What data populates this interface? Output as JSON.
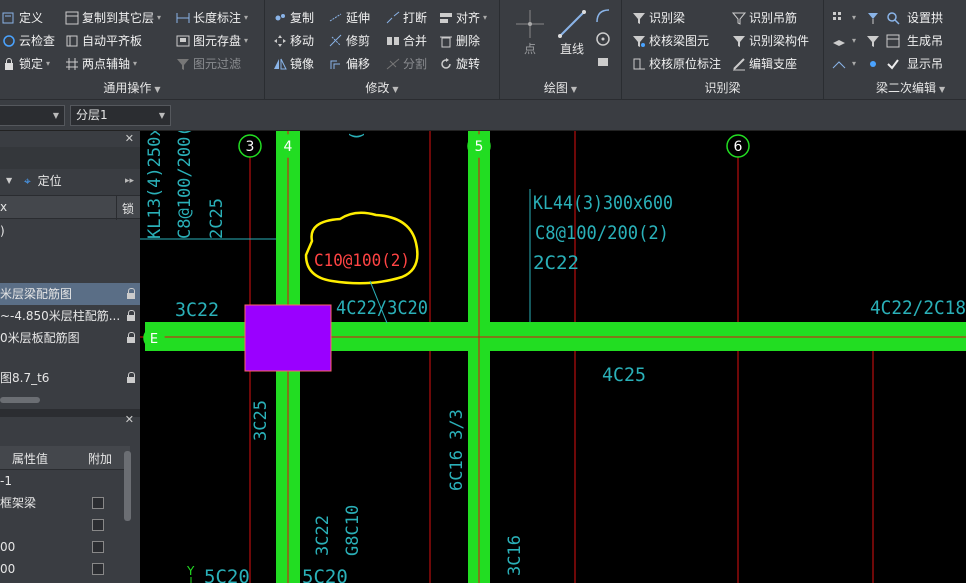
{
  "ribbon": {
    "groups": {
      "common": {
        "title": "通用操作",
        "items": [
          "定义",
          "复制到其它层",
          "长度标注",
          "云检查",
          "自动平齐板",
          "图元存盘",
          "锁定",
          "两点辅轴",
          "图元过滤"
        ]
      },
      "modify": {
        "title": "修改",
        "items": [
          "复制",
          "延伸",
          "打断",
          "对齐",
          "移动",
          "修剪",
          "合并",
          "删除",
          "镜像",
          "偏移",
          "分割",
          "旋转"
        ]
      },
      "draw": {
        "title": "绘图",
        "point": "点",
        "line": "直线"
      },
      "identify_beam": {
        "title": "识别梁",
        "items": [
          "识别梁",
          "识别吊筋",
          "校核梁图元",
          "识别梁构件",
          "校核原位标注",
          "编辑支座"
        ]
      },
      "beam_edit": {
        "title": "梁二次编辑",
        "items": [
          "设置拱",
          "生成吊",
          "显示吊"
        ]
      }
    }
  },
  "layerbar": {
    "floor_combo": "分层1"
  },
  "leftpanel": {
    "locate_label": "定位",
    "lock_col": "锁",
    "row_paren": ")",
    "row_x": "x",
    "drawings": [
      "米层梁配筋图",
      "~-4.850米层柱配筋...",
      "0米层板配筋图",
      "图8.7_t6"
    ],
    "props_header": {
      "value": "属性值",
      "extra": "附加"
    },
    "props": [
      "-1",
      "框架梁",
      "",
      "00",
      "00"
    ]
  },
  "canvas": {
    "axes": {
      "a3": "3",
      "a4": "4",
      "a5": "5",
      "a6": "6",
      "aE": "E"
    },
    "annotations": {
      "kl13": "KL13(4)250x",
      "kl13_stirrup": "C8@100/200(2",
      "kl13_top": "2C25",
      "kl44": "KL44(3)300x600",
      "kl44_stirrup": "C8@100/200(2)",
      "kl44_top": "2C22",
      "circled": "C10@100(2)",
      "left_3c22": "3C22",
      "mid_4c22": "4C22/3C20",
      "right_4c22": "4C22/2C18",
      "bottom_4c25": "4C25",
      "v_3c25": "3C25",
      "v_6c16": "6C16 3/3",
      "v_3c22": "3C22",
      "v_g8c10": "G8C10",
      "v_3c16": "3C16",
      "bottom_5c20a": "5C20",
      "bottom_5c20b": "5C20",
      "y_label": "Y"
    },
    "colors": {
      "beam": "#22dd22",
      "axis_red": "#dd1111",
      "cyan_text": "#2ab0b8",
      "column": "#9a00ff",
      "highlight": "#ffee00"
    }
  }
}
